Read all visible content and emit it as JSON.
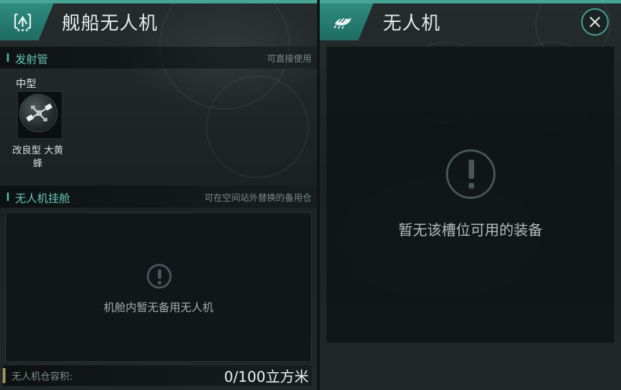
{
  "left_panel": {
    "title": "舰船无人机",
    "icon": "ship-drone-icon",
    "launch_tubes": {
      "section_title": "发射管",
      "hint": "可直接使用",
      "slot": {
        "size_label": "中型",
        "drone_name": "改良型 大黄蜂",
        "icon": "drone-icon"
      }
    },
    "drone_bay": {
      "section_title": "无人机挂舱",
      "hint": "可在空间站外替换的备用仓",
      "empty_message": "机舱内暂无备用无人机",
      "icon": "alert-icon"
    },
    "capacity": {
      "label": "无人机仓容积:",
      "value": "0/100立方米"
    }
  },
  "right_panel": {
    "title": "无人机",
    "icon": "drone-bee-icon",
    "empty_message": "暂无该槽位可用的装备",
    "icon_alert": "alert-icon",
    "close_icon": "close-icon"
  },
  "colors": {
    "accent": "#46a597",
    "accent_text": "#67c5b5",
    "capacity_tag": "#a48f59"
  }
}
